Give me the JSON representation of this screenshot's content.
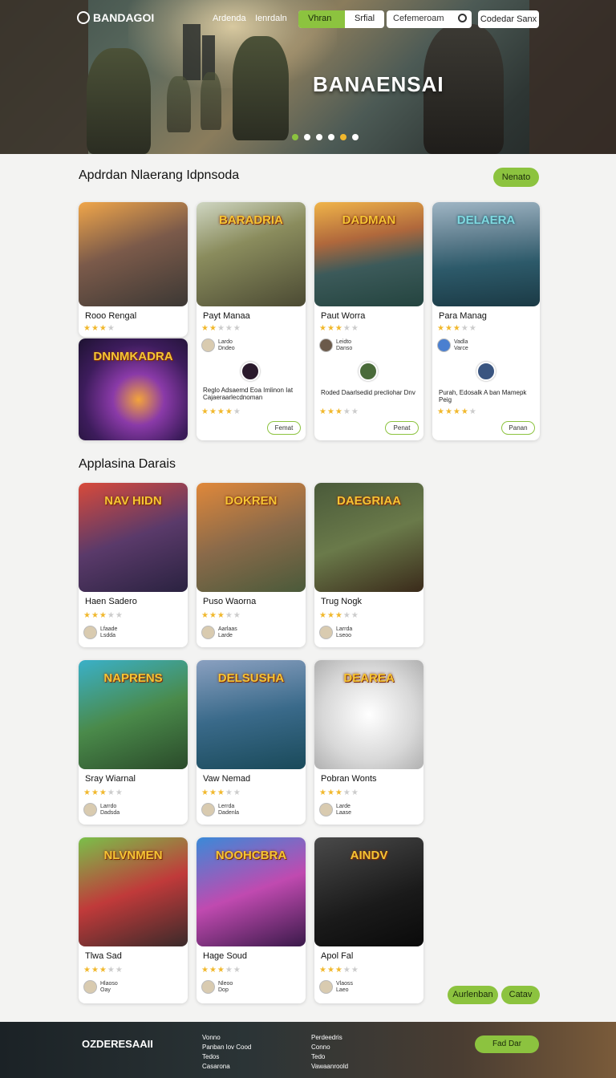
{
  "header": {
    "logo": "BANDAGOI",
    "nav": [
      "Ardenda",
      "Ienrdaln"
    ],
    "segment": [
      "Vhran",
      "Srfial"
    ],
    "search_placeholder": "Cefemeroam",
    "button": "Codedar Sanx",
    "hero_title": "BANAENSAI"
  },
  "colors": {
    "accent": "#8cc33f",
    "star": "#f1b82d"
  },
  "section1": {
    "title": "Apdrdan Nlaerang Idpnsoda",
    "button": "Nenato",
    "cards": [
      {
        "title": "Rooo Rengal",
        "stars": 3
      },
      {
        "title": "Payt Manaa",
        "stars": 2,
        "dev": [
          "Lardo",
          "Dndeo"
        ],
        "desc": "Reglo Adsaemd Eoa Imlinon Iat Cajaeraarlecdnoman",
        "stars2": 4,
        "action": "Femat",
        "thumb": "BARADRIA"
      },
      {
        "title": "Paut Worra",
        "stars": 3,
        "dev": [
          "Leidto",
          "Danso"
        ],
        "desc": "Roded Daarlsedid precliohar Dnv",
        "stars2": 3,
        "action": "Penat",
        "thumb": "DADMAN"
      },
      {
        "title": "Para Manag",
        "stars": 3,
        "dev": [
          "Vadla",
          "Varce"
        ],
        "desc": "Purah, Edosalk A ban Mamepk Peig",
        "stars2": 4,
        "action": "Panan",
        "thumb": "DELAERA"
      },
      {
        "title": "",
        "thumb": "DNNMKADRA"
      }
    ]
  },
  "section2": {
    "title": "Applasina Darais",
    "cards": [
      {
        "title": "Haen Sadero",
        "stars": 3,
        "dev": [
          "Lfaade",
          "Lsdda"
        ],
        "thumb": "NAV HIDN"
      },
      {
        "title": "Puso Waorna",
        "stars": 3,
        "dev": [
          "Aarlaas",
          "Larde"
        ],
        "thumb": "DOKREN"
      },
      {
        "title": "Trug Nogk",
        "stars": 3,
        "dev": [
          "Larrda",
          "Lseoo"
        ],
        "thumb": "DAEGRIAA"
      },
      {
        "title": "Sray Wiarnal",
        "stars": 3,
        "dev": [
          "Larrdo",
          "Dadsda"
        ],
        "thumb": "NAPRENS"
      },
      {
        "title": "Vaw Nemad",
        "stars": 3,
        "dev": [
          "Lerrda",
          "Dadenla"
        ],
        "thumb": "DELSUSHA"
      },
      {
        "title": "Pobran Wonts",
        "stars": 3,
        "dev": [
          "Larde",
          "Laase"
        ],
        "thumb": "DEAREA"
      },
      {
        "title": "Tlwa Sad",
        "stars": 3,
        "dev": [
          "Hlaoso",
          "Oay"
        ],
        "thumb": "NLVNMEN"
      },
      {
        "title": "Hage Soud",
        "stars": 3,
        "dev": [
          "Nleoo",
          "Dop"
        ],
        "thumb": "NOOHCBRA"
      },
      {
        "title": "Apol Fal",
        "stars": 3,
        "dev": [
          "Vlaoss",
          "Laeo"
        ],
        "thumb": "AINDV"
      }
    ],
    "buttons": [
      "Aurlenban",
      "Catav"
    ]
  },
  "footer": {
    "logo": "OZDERESAAII",
    "col1": [
      "Vonno",
      "Panban lov Cood",
      "Tedos",
      "Casarona"
    ],
    "col2": [
      "Perdeedris",
      "Conno",
      "Tedo",
      "Vawaanroold"
    ],
    "button": "Fad Dar"
  }
}
